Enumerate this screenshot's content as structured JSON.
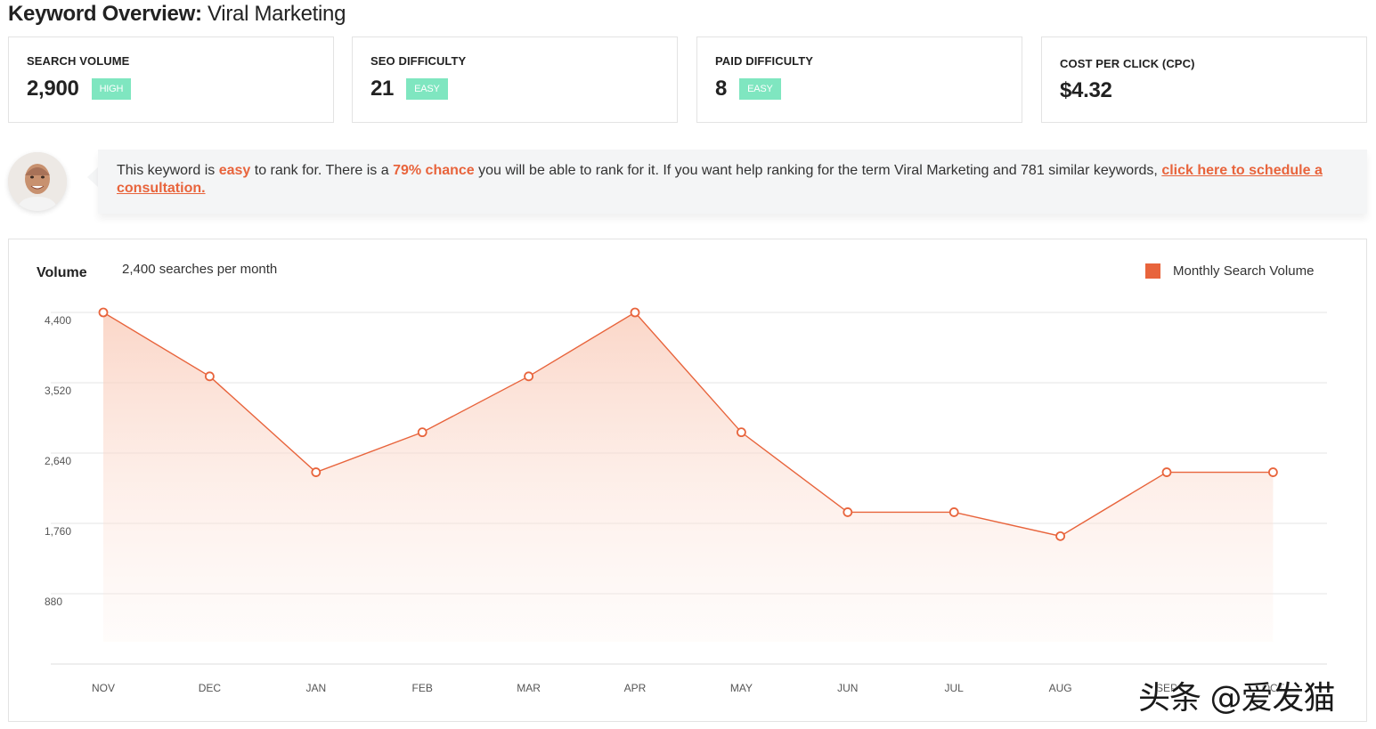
{
  "header": {
    "title_bold": "Keyword Overview:",
    "title_keyword": "Viral Marketing"
  },
  "cards": [
    {
      "label": "SEARCH VOLUME",
      "value": "2,900",
      "badge": "HIGH"
    },
    {
      "label": "SEO DIFFICULTY",
      "value": "21",
      "badge": "EASY"
    },
    {
      "label": "PAID DIFFICULTY",
      "value": "8",
      "badge": "EASY"
    },
    {
      "label": "COST PER CLICK (CPC)",
      "value": "$4.32",
      "badge": ""
    }
  ],
  "advice": {
    "t1": "This keyword is ",
    "easy": "easy",
    "t2": " to rank for. There is a ",
    "chance": "79% chance",
    "t3": " you will be able to rank for it. If you want help ranking for the term Viral Marketing and 781 similar keywords, ",
    "link": "click here to schedule a consultation."
  },
  "chart_meta": {
    "volume_label": "Volume",
    "searches_text": "2,400 searches per month"
  },
  "chart_data": {
    "type": "area",
    "categories": [
      "NOV",
      "DEC",
      "JAN",
      "FEB",
      "MAR",
      "APR",
      "MAY",
      "JUN",
      "JUL",
      "AUG",
      "SEP",
      "OCT"
    ],
    "series": [
      {
        "name": "Monthly Search Volume",
        "values": [
          4400,
          3600,
          2400,
          2900,
          3600,
          4400,
          2900,
          1900,
          1900,
          1600,
          2400,
          2400
        ]
      }
    ],
    "y_ticks": [
      880,
      1760,
      2640,
      3520,
      4400
    ],
    "y_tick_labels": [
      "880",
      "1,760",
      "2,640",
      "3,520",
      "4,400"
    ],
    "ylim": [
      0,
      4400
    ],
    "grid": true,
    "legend": "top-right"
  },
  "colors": {
    "accent": "#e8643c",
    "badge": "#7fe6c0",
    "grid": "#e6e6e6"
  },
  "watermark": "头条 @爱发猫"
}
